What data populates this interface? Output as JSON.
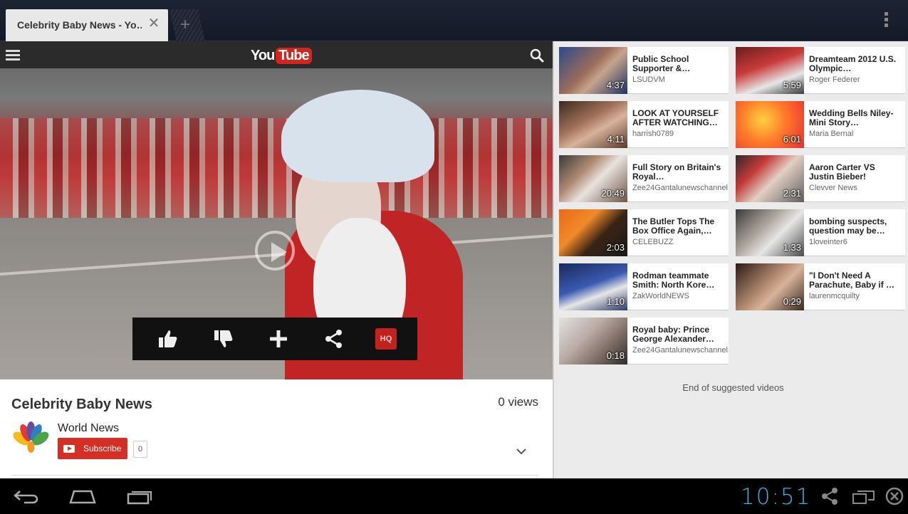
{
  "browser": {
    "tab_title": "Celebrity Baby News - Yo…",
    "close_glyph": "✕",
    "new_tab_glyph": "+"
  },
  "youtube": {
    "logo_you": "You",
    "logo_tube": "Tube",
    "brand_color": "#d0261e"
  },
  "player": {
    "actions": [
      "like-icon",
      "dislike-icon",
      "add-to-playlist-icon",
      "share-icon"
    ],
    "hq_label": "HQ"
  },
  "video_info": {
    "title": "Celebrity Baby News",
    "views": "0 views",
    "channel": "World News",
    "subscribe_label": "Subscribe",
    "subscriber_count": "0"
  },
  "suggestions": [
    {
      "title": "Public School Supporter &…",
      "channel": "LSUDVM",
      "duration": "4:37"
    },
    {
      "title": "Dreamteam 2012 U.S. Olympic…",
      "channel": "Roger Federer",
      "duration": "5:59"
    },
    {
      "title": "LOOK AT YOURSELF AFTER WATCHING…",
      "channel": "harrish0789",
      "duration": "4:11"
    },
    {
      "title": "Wedding Bells Niley-Mini Story…",
      "channel": "Maria Bernal",
      "duration": "6:01"
    },
    {
      "title": "Full Story on Britain's Royal…",
      "channel": "Zee24Gantalunewschannel",
      "duration": "20:49"
    },
    {
      "title": "Aaron Carter VS Justin Bieber!",
      "channel": "Clevver News",
      "duration": "2:31"
    },
    {
      "title": "The Butler Tops The Box Office Again,…",
      "channel": "CELEBUZZ",
      "duration": "2:03"
    },
    {
      "title": "bombing suspects, question may be…",
      "channel": "1loveinter6",
      "duration": "1:33"
    },
    {
      "title": "Rodman teammate Smith: North Kore…",
      "channel": "ZakWorldNEWS",
      "duration": "1:10"
    },
    {
      "title": "\"I Don't Need A Parachute, Baby if …",
      "channel": "laurenmcquilty",
      "duration": "0:29"
    },
    {
      "title": "Royal baby: Prince George Alexander…",
      "channel": "Zee24Gantalunewschannel",
      "duration": "0:18"
    }
  ],
  "end_of_suggestions": "End of suggested videos",
  "system_bar": {
    "clock": "10:51",
    "clock_color": "#33b5e5"
  }
}
